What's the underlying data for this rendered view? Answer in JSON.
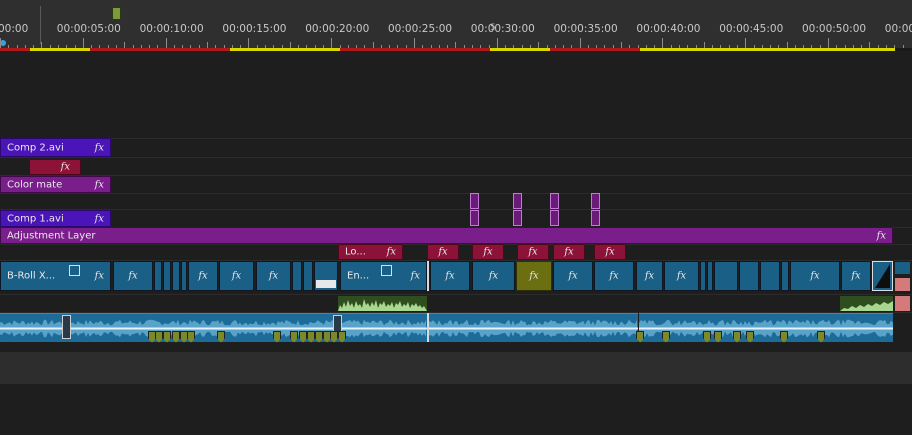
{
  "ruler": {
    "labels": [
      "00:00",
      "00:00:05:00",
      "00:00:10:00",
      "00:00:15:00",
      "00:00:20:00",
      "00:00:25:00",
      "00:00:30:00",
      "00:00:35:00",
      "00:00:40:00",
      "00:00:45:00",
      "00:00:50:00",
      "00:00:5"
    ],
    "marker_number": "5"
  },
  "colors": {
    "video_clip": "#1a5f86",
    "title_clip": "#4a14b8",
    "adjustment": "#7a1e8c",
    "effect_clip": "#8c1238",
    "selected_clip": "#6b6f12",
    "audio": "#1c6b98",
    "waveform": "#8fd0f0",
    "range_red": "#b01818",
    "range_yellow": "#d8d800"
  },
  "tracks": {
    "comp2": {
      "label": "Comp 2.avi",
      "fx": "fx"
    },
    "effect_small": {
      "fx": "fx"
    },
    "colormate": {
      "label": "Color mate",
      "fx": "fx"
    },
    "comp1": {
      "label": "Comp 1.avi",
      "fx": "fx"
    },
    "adjustment": {
      "label": "Adjustment Layer",
      "fx": "fx"
    },
    "effects_row": {
      "lo_label": "Lo...",
      "fx": "fx"
    },
    "video": {
      "broll_label": "B-Roll X...",
      "en_label": "En...",
      "fx": "fx"
    }
  }
}
